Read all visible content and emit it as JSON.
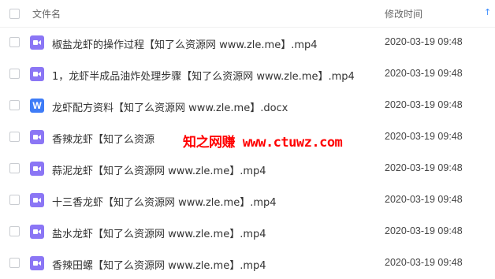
{
  "header": {
    "name_label": "文件名",
    "time_label": "修改时间",
    "sort_icon": "arrow-up-icon"
  },
  "files": [
    {
      "type": "video",
      "name": "椒盐龙虾的操作过程【知了么资源网 www.zle.me】.mp4",
      "time": "2020-03-19 09:48"
    },
    {
      "type": "video",
      "name": "1，龙虾半成品油炸处理步骤【知了么资源网 www.zle.me】.mp4",
      "time": "2020-03-19 09:48"
    },
    {
      "type": "doc",
      "icon_letter": "W",
      "name": "龙虾配方资料【知了么资源网 www.zle.me】.docx",
      "time": "2020-03-19 09:48"
    },
    {
      "type": "video",
      "name": "香辣龙虾【知了么资源网 www.zle.me】.mp4",
      "time": "2020-03-19 09:48"
    },
    {
      "type": "video",
      "name": "蒜泥龙虾【知了么资源网 www.zle.me】.mp4",
      "time": "2020-03-19 09:48"
    },
    {
      "type": "video",
      "name": "十三香龙虾【知了么资源网 www.zle.me】.mp4",
      "time": "2020-03-19 09:48"
    },
    {
      "type": "video",
      "name": "盐水龙虾【知了么资源网 www.zle.me】.mp4",
      "time": "2020-03-19 09:48"
    },
    {
      "type": "video",
      "name": "香辣田螺【知了么资源网 www.zle.me】.mp4",
      "time": "2020-03-19 09:48"
    }
  ],
  "watermark": "知之网赚 www.ctuwz.com",
  "colors": {
    "video_icon": "#8b76f5",
    "doc_icon": "#3e7cf7",
    "watermark": "#ff0000",
    "sort_icon": "#3b8cff"
  }
}
